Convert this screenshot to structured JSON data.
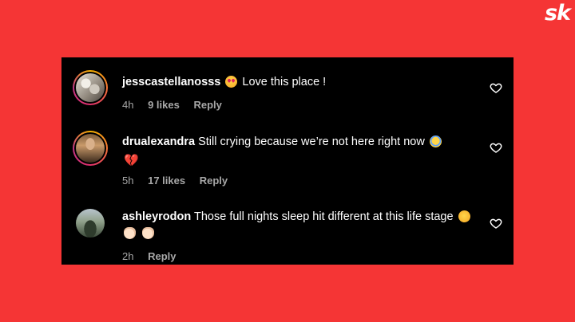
{
  "brand": {
    "logo_text": "sk"
  },
  "comments": [
    {
      "username": "jesscastellanosss",
      "emoji_before": "heart-eyes-emoji",
      "text": "Love this place !",
      "time": "4h",
      "likes": "9 likes",
      "reply_label": "Reply",
      "like_icon": "heart-outline-icon"
    },
    {
      "username": "drualexandra",
      "text": "Still crying because we’re not here right now",
      "emoji_after": [
        "crying-face-emoji",
        "broken-heart-emoji"
      ],
      "time": "5h",
      "likes": "17 likes",
      "reply_label": "Reply",
      "like_icon": "heart-outline-icon"
    },
    {
      "username": "ashleyrodon",
      "text": "Those full nights sleep hit different at this life stage",
      "emoji_after": [
        "rofl-emoji",
        "clapping-hands-emoji",
        "clapping-hands-emoji"
      ],
      "time": "2h",
      "reply_label": "Reply",
      "like_icon": "heart-outline-icon"
    }
  ],
  "colors": {
    "background": "#f53535",
    "panel": "#000000",
    "text": "#ffffff",
    "meta_text": "#a8a8a8"
  }
}
